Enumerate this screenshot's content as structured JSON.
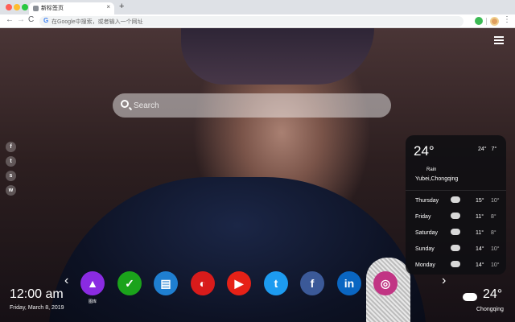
{
  "browser": {
    "tab_title": "新标签页",
    "tab_close": "×",
    "newtab": "+",
    "omnibox_placeholder": "在Google中搜索，或者输入一个网址",
    "back": "←",
    "forward": "→",
    "reload": "C",
    "g_icon": "G",
    "menu": "⋮"
  },
  "search": {
    "placeholder": "Search"
  },
  "social": [
    {
      "label": "f",
      "icon": "facebook-icon"
    },
    {
      "label": "t",
      "icon": "twitter-icon"
    },
    {
      "label": "s",
      "icon": "snapchat-icon"
    },
    {
      "label": "w",
      "icon": "wechat-icon"
    }
  ],
  "weather_card": {
    "temp": "24°",
    "high": "24°",
    "low": "7°",
    "condition": "Rain",
    "location": "Yubei,Chongqing",
    "forecast": [
      {
        "day": "Thursday",
        "high": "15°",
        "low": "10°"
      },
      {
        "day": "Friday",
        "high": "11°",
        "low": "8°"
      },
      {
        "day": "Saturday",
        "high": "11°",
        "low": "8°"
      },
      {
        "day": "Sunday",
        "high": "14°",
        "low": "10°"
      },
      {
        "day": "Monday",
        "high": "14°",
        "low": "10°"
      }
    ]
  },
  "dock": {
    "prev": "‹",
    "next": "›",
    "apps": [
      {
        "label": "图库",
        "icon": "gallery-icon",
        "color": "#8a2be2",
        "glyph": "▲"
      },
      {
        "label": "",
        "icon": "check-icon",
        "color": "#1ba31b",
        "glyph": "✓"
      },
      {
        "label": "",
        "icon": "notes-icon",
        "color": "#1f7fd1",
        "glyph": "▤"
      },
      {
        "label": "",
        "icon": "games-icon",
        "color": "#d81b1b",
        "glyph": "◐"
      },
      {
        "label": "",
        "icon": "youtube-icon",
        "color": "#e62117",
        "glyph": "▶"
      },
      {
        "label": "",
        "icon": "twitter-icon",
        "color": "#1d9bf0",
        "glyph": "t"
      },
      {
        "label": "",
        "icon": "facebook-icon",
        "color": "#3b5998",
        "glyph": "f"
      },
      {
        "label": "",
        "icon": "linkedin-icon",
        "color": "#0a66c2",
        "glyph": "in"
      },
      {
        "label": "",
        "icon": "instagram-icon",
        "color": "#c13584",
        "glyph": "◎"
      }
    ]
  },
  "clock": {
    "time": "12:00 am",
    "date": "Friday, March 8, 2019"
  },
  "bottom_weather": {
    "temp": "24°",
    "city": "Chongqing"
  }
}
